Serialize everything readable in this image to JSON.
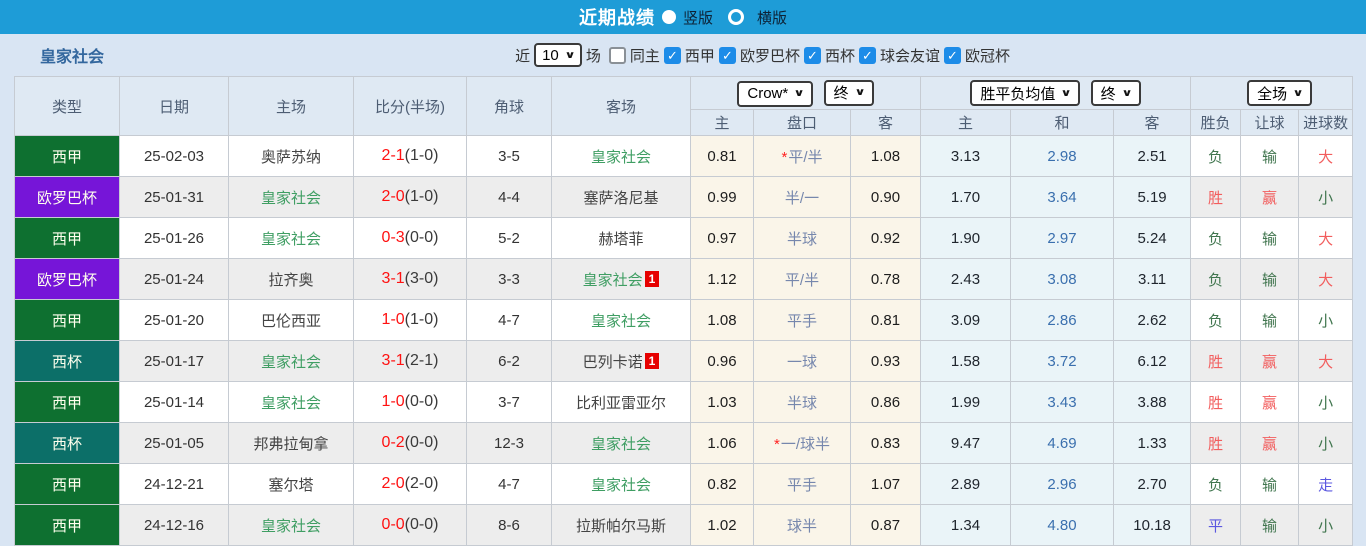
{
  "title_bar": {
    "title": "近期战绩",
    "radio_vertical": "竖版",
    "radio_horizontal": "横版"
  },
  "filter_bar": {
    "team": "皇家社会",
    "near_label": "近",
    "near_value": "10",
    "games_label": "场",
    "same_home_label": "同主",
    "leagues": [
      {
        "label": "西甲",
        "checked": true
      },
      {
        "label": "欧罗巴杯",
        "checked": true
      },
      {
        "label": "西杯",
        "checked": true
      },
      {
        "label": "球会友谊",
        "checked": true
      },
      {
        "label": "欧冠杯",
        "checked": true
      }
    ]
  },
  "table": {
    "selects": {
      "odds_company": "Crow*",
      "odds_stage": "终",
      "avg_label": "胜平负均值",
      "avg_stage": "终",
      "scope": "全场"
    },
    "header_cols": [
      "类型",
      "日期",
      "主场",
      "比分(半场)",
      "角球",
      "客场"
    ],
    "sub_cols": [
      "主",
      "盘口",
      "客",
      "主",
      "和",
      "客",
      "胜负",
      "让球",
      "进球数"
    ],
    "rows": [
      {
        "type": {
          "label": "西甲",
          "color": "liga"
        },
        "date": "25-02-03",
        "home": {
          "name": "奥萨苏纳",
          "is_team": false,
          "red_cards": ""
        },
        "score": {
          "full": "2-1",
          "half": "(1-0)"
        },
        "corners": "3-5",
        "away": {
          "name": "皇家社会",
          "is_team": true,
          "red_cards": ""
        },
        "odds": {
          "home": "0.81",
          "star": true,
          "handicap": "平/半",
          "away": "1.08"
        },
        "avg": {
          "win": "3.13",
          "draw": "2.98",
          "lose": "2.51"
        },
        "results": [
          {
            "text": "负",
            "color": "green"
          },
          {
            "text": "输",
            "color": "green"
          },
          {
            "text": "大",
            "color": "red"
          }
        ]
      },
      {
        "type": {
          "label": "欧罗巴杯",
          "color": "europa"
        },
        "date": "25-01-31",
        "home": {
          "name": "皇家社会",
          "is_team": true,
          "red_cards": ""
        },
        "score": {
          "full": "2-0",
          "half": "(1-0)"
        },
        "corners": "4-4",
        "away": {
          "name": "塞萨洛尼基",
          "is_team": false,
          "red_cards": ""
        },
        "odds": {
          "home": "0.99",
          "star": false,
          "handicap": "半/一",
          "away": "0.90"
        },
        "avg": {
          "win": "1.70",
          "draw": "3.64",
          "lose": "5.19"
        },
        "results": [
          {
            "text": "胜",
            "color": "red"
          },
          {
            "text": "赢",
            "color": "red"
          },
          {
            "text": "小",
            "color": "green"
          }
        ]
      },
      {
        "type": {
          "label": "西甲",
          "color": "liga"
        },
        "date": "25-01-26",
        "home": {
          "name": "皇家社会",
          "is_team": true,
          "red_cards": ""
        },
        "score": {
          "full": "0-3",
          "half": "(0-0)"
        },
        "corners": "5-2",
        "away": {
          "name": "赫塔菲",
          "is_team": false,
          "red_cards": ""
        },
        "odds": {
          "home": "0.97",
          "star": false,
          "handicap": "半球",
          "away": "0.92"
        },
        "avg": {
          "win": "1.90",
          "draw": "2.97",
          "lose": "5.24"
        },
        "results": [
          {
            "text": "负",
            "color": "green"
          },
          {
            "text": "输",
            "color": "green"
          },
          {
            "text": "大",
            "color": "red"
          }
        ]
      },
      {
        "type": {
          "label": "欧罗巴杯",
          "color": "europa"
        },
        "date": "25-01-24",
        "home": {
          "name": "拉齐奥",
          "is_team": false,
          "red_cards": ""
        },
        "score": {
          "full": "3-1",
          "half": "(3-0)"
        },
        "corners": "3-3",
        "away": {
          "name": "皇家社会",
          "is_team": true,
          "red_cards": "1"
        },
        "odds": {
          "home": "1.12",
          "star": false,
          "handicap": "平/半",
          "away": "0.78"
        },
        "avg": {
          "win": "2.43",
          "draw": "3.08",
          "lose": "3.11"
        },
        "results": [
          {
            "text": "负",
            "color": "green"
          },
          {
            "text": "输",
            "color": "green"
          },
          {
            "text": "大",
            "color": "red"
          }
        ]
      },
      {
        "type": {
          "label": "西甲",
          "color": "liga"
        },
        "date": "25-01-20",
        "home": {
          "name": "巴伦西亚",
          "is_team": false,
          "red_cards": ""
        },
        "score": {
          "full": "1-0",
          "half": "(1-0)"
        },
        "corners": "4-7",
        "away": {
          "name": "皇家社会",
          "is_team": true,
          "red_cards": ""
        },
        "odds": {
          "home": "1.08",
          "star": false,
          "handicap": "平手",
          "away": "0.81"
        },
        "avg": {
          "win": "3.09",
          "draw": "2.86",
          "lose": "2.62"
        },
        "results": [
          {
            "text": "负",
            "color": "green"
          },
          {
            "text": "输",
            "color": "green"
          },
          {
            "text": "小",
            "color": "green"
          }
        ]
      },
      {
        "type": {
          "label": "西杯",
          "color": "copa"
        },
        "date": "25-01-17",
        "home": {
          "name": "皇家社会",
          "is_team": true,
          "red_cards": ""
        },
        "score": {
          "full": "3-1",
          "half": "(2-1)"
        },
        "corners": "6-2",
        "away": {
          "name": "巴列卡诺",
          "is_team": false,
          "red_cards": "1"
        },
        "odds": {
          "home": "0.96",
          "star": false,
          "handicap": "一球",
          "away": "0.93"
        },
        "avg": {
          "win": "1.58",
          "draw": "3.72",
          "lose": "6.12"
        },
        "results": [
          {
            "text": "胜",
            "color": "red"
          },
          {
            "text": "赢",
            "color": "red"
          },
          {
            "text": "大",
            "color": "red"
          }
        ]
      },
      {
        "type": {
          "label": "西甲",
          "color": "liga"
        },
        "date": "25-01-14",
        "home": {
          "name": "皇家社会",
          "is_team": true,
          "red_cards": ""
        },
        "score": {
          "full": "1-0",
          "half": "(0-0)"
        },
        "corners": "3-7",
        "away": {
          "name": "比利亚雷亚尔",
          "is_team": false,
          "red_cards": ""
        },
        "odds": {
          "home": "1.03",
          "star": false,
          "handicap": "半球",
          "away": "0.86"
        },
        "avg": {
          "win": "1.99",
          "draw": "3.43",
          "lose": "3.88"
        },
        "results": [
          {
            "text": "胜",
            "color": "red"
          },
          {
            "text": "赢",
            "color": "red"
          },
          {
            "text": "小",
            "color": "green"
          }
        ]
      },
      {
        "type": {
          "label": "西杯",
          "color": "copa"
        },
        "date": "25-01-05",
        "home": {
          "name": "邦弗拉甸拿",
          "is_team": false,
          "red_cards": ""
        },
        "score": {
          "full": "0-2",
          "half": "(0-0)"
        },
        "corners": "12-3",
        "away": {
          "name": "皇家社会",
          "is_team": true,
          "red_cards": ""
        },
        "odds": {
          "home": "1.06",
          "star": true,
          "handicap": "一/球半",
          "away": "0.83"
        },
        "avg": {
          "win": "9.47",
          "draw": "4.69",
          "lose": "1.33"
        },
        "results": [
          {
            "text": "胜",
            "color": "red"
          },
          {
            "text": "赢",
            "color": "red"
          },
          {
            "text": "小",
            "color": "green"
          }
        ]
      },
      {
        "type": {
          "label": "西甲",
          "color": "liga"
        },
        "date": "24-12-21",
        "home": {
          "name": "塞尔塔",
          "is_team": false,
          "red_cards": ""
        },
        "score": {
          "full": "2-0",
          "half": "(2-0)"
        },
        "corners": "4-7",
        "away": {
          "name": "皇家社会",
          "is_team": true,
          "red_cards": ""
        },
        "odds": {
          "home": "0.82",
          "star": false,
          "handicap": "平手",
          "away": "1.07"
        },
        "avg": {
          "win": "2.89",
          "draw": "2.96",
          "lose": "2.70"
        },
        "results": [
          {
            "text": "负",
            "color": "green"
          },
          {
            "text": "输",
            "color": "green"
          },
          {
            "text": "走",
            "color": "blue"
          }
        ]
      },
      {
        "type": {
          "label": "西甲",
          "color": "liga"
        },
        "date": "24-12-16",
        "home": {
          "name": "皇家社会",
          "is_team": true,
          "red_cards": ""
        },
        "score": {
          "full": "0-0",
          "half": "(0-0)"
        },
        "corners": "8-6",
        "away": {
          "name": "拉斯帕尔马斯",
          "is_team": false,
          "red_cards": ""
        },
        "odds": {
          "home": "1.02",
          "star": false,
          "handicap": "球半",
          "away": "0.87"
        },
        "avg": {
          "win": "1.34",
          "draw": "4.80",
          "lose": "10.18"
        },
        "results": [
          {
            "text": "平",
            "color": "blue"
          },
          {
            "text": "输",
            "color": "green"
          },
          {
            "text": "小",
            "color": "green"
          }
        ]
      }
    ]
  },
  "colors": {
    "title_bar_bg": "#1e9cd7",
    "checkbox_blue": "#1d8ce8",
    "laliga_badge": "#0e7030",
    "europa_badge": "#7615d8",
    "copa_badge": "#0c6f68",
    "team_link_green": "#3f9e63",
    "score_red": "#ff1111",
    "red_card_bg": "#e60000",
    "win_red": "#f25e5e",
    "lose_green": "#41764f",
    "push_blue": "#5b58e0",
    "handicap_slate": "#7687ad",
    "avg_draw_blue": "#3a6fae",
    "odds_bg": "#faf5e9",
    "avg_bg": "#eaf4f8",
    "header_bg": "#dfe9f3",
    "page_bg": "#d9e5f3"
  }
}
